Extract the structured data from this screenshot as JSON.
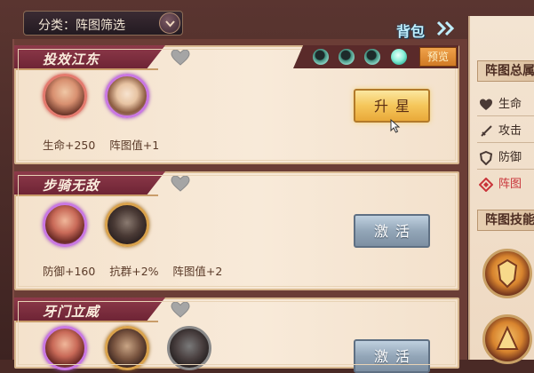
{
  "filter": {
    "label": "分类：阵图筛选"
  },
  "bag": {
    "label": "背包"
  },
  "preview": {
    "label": "预览"
  },
  "progress": {
    "total_orbs": 4,
    "lit_orbs": 1
  },
  "formations": [
    {
      "name": "投效江东",
      "bonus": "生命+250    阵图值+1",
      "button": "升星",
      "button_style": "gold",
      "avatars": [
        "red",
        "purple"
      ]
    },
    {
      "name": "步骑无敌",
      "bonus": "防御+160    抗群+2%    阵图值+2",
      "button": "激活",
      "button_style": "grey",
      "avatars": [
        "purple",
        "gold"
      ]
    },
    {
      "name": "牙门立威",
      "bonus": "",
      "button": "激活",
      "button_style": "grey",
      "avatars": [
        "purple",
        "gold",
        "grey"
      ]
    }
  ],
  "right_panel": {
    "title1": "阵图总属",
    "stats": [
      {
        "icon": "heart-icon",
        "label": "生命"
      },
      {
        "icon": "sword-icon",
        "label": "攻击"
      },
      {
        "icon": "shield-icon",
        "label": "防御"
      },
      {
        "icon": "diamond-icon",
        "label": "阵图"
      }
    ],
    "title2": "阵图技能"
  },
  "colors": {
    "accent_gold": "#f5c65a",
    "banner": "#8e3a4a",
    "highlight_red": "#c9343a"
  }
}
